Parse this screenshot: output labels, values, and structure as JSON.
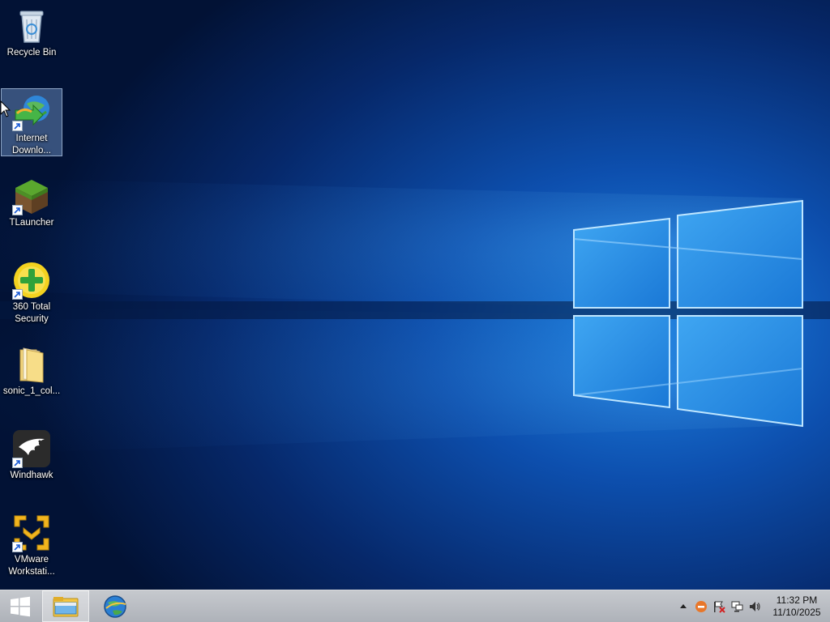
{
  "desktop": {
    "icons": [
      {
        "label": "Recycle Bin",
        "icon": "recycle-bin-icon",
        "shortcut": false
      },
      {
        "label": "Internet\nDownlo...",
        "icon": "internet-download-manager-icon",
        "shortcut": true,
        "selected": true
      },
      {
        "label": "TLauncher",
        "icon": "tlauncher-icon",
        "shortcut": true
      },
      {
        "label": "360 Total\nSecurity",
        "icon": "360-total-security-icon",
        "shortcut": true
      },
      {
        "label": "sonic_1_col...",
        "icon": "folder-icon",
        "shortcut": false
      },
      {
        "label": "Windhawk",
        "icon": "windhawk-icon",
        "shortcut": true
      },
      {
        "label": "VMware\nWorkstati...",
        "icon": "vmware-workstation-icon",
        "shortcut": true
      }
    ]
  },
  "taskbar": {
    "start_icon": "windows-logo-icon",
    "pinned": [
      {
        "name": "File Explorer",
        "icon": "file-explorer-icon",
        "active": true
      },
      {
        "name": "Browser",
        "icon": "browser-globe-icon",
        "active": false
      }
    ],
    "tray": {
      "icons": [
        "show-hidden-icons-chevron",
        "360-tray-icon",
        "action-center-flag-icon",
        "network-icon",
        "volume-icon"
      ],
      "time": "11:32 PM",
      "date": "11/10/2025"
    }
  },
  "colors": {
    "wallpaper_dark": "#041c4a",
    "wallpaper_glow": "#1a7fe0",
    "taskbar": "#b8bcc3"
  }
}
